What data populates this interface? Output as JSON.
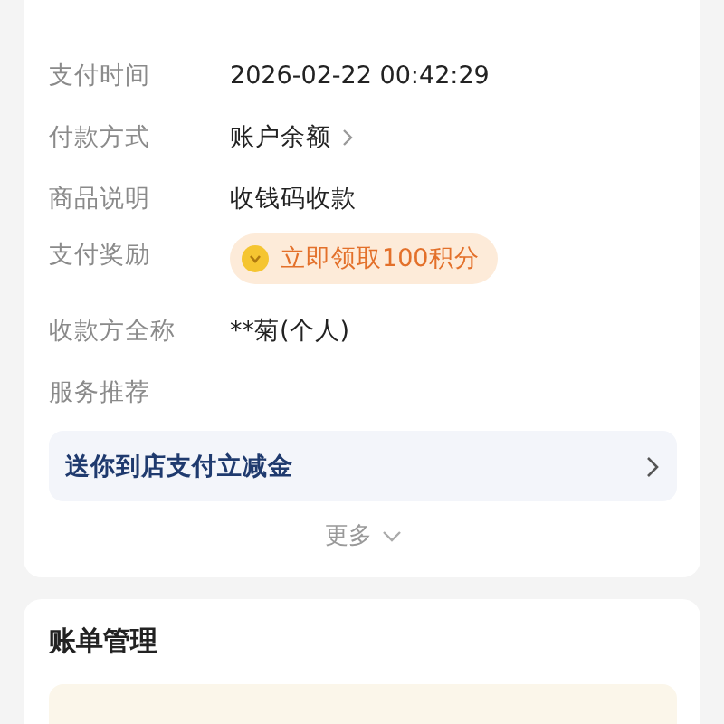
{
  "rows": [
    {
      "label": "支付时间",
      "value": "2026-02-22 00:42:29",
      "kind": "text"
    },
    {
      "label": "付款方式",
      "value": "账户余额",
      "kind": "link"
    },
    {
      "label": "商品说明",
      "value": "收钱码收款",
      "kind": "text"
    },
    {
      "label": "支付奖励",
      "value": "立即领取100积分",
      "kind": "reward"
    },
    {
      "label": "收款方全称",
      "value": "**菊(个人)",
      "kind": "text"
    },
    {
      "label": "服务推荐",
      "kind": "section"
    }
  ],
  "service_banner": {
    "text": "送你到店支付立减金"
  },
  "more": {
    "label": "更多"
  },
  "bill_management": {
    "title": "账单管理"
  }
}
